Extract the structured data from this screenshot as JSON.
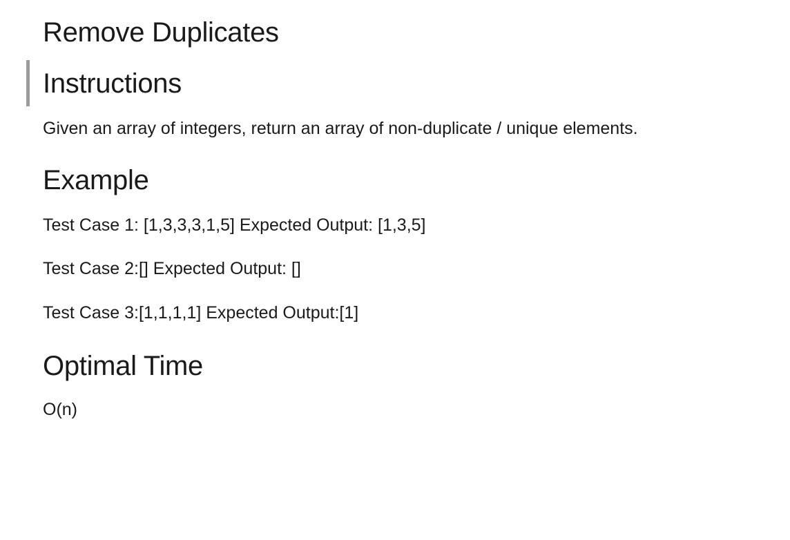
{
  "title": "Remove Duplicates",
  "sections": {
    "instructions": {
      "heading": "Instructions",
      "text": "Given an array of integers, return an array of non-duplicate / unique elements."
    },
    "example": {
      "heading": "Example",
      "cases": [
        "Test Case 1: [1,3,3,3,1,5] Expected Output: [1,3,5]",
        "Test Case 2:[] Expected Output: []",
        "Test Case 3:[1,1,1,1] Expected Output:[1]"
      ]
    },
    "optimal_time": {
      "heading": "Optimal Time",
      "text": "O(n)"
    }
  },
  "colors": {
    "text": "#1a1a1a",
    "background": "#ffffff",
    "cell_marker": "#9b9b9b"
  }
}
